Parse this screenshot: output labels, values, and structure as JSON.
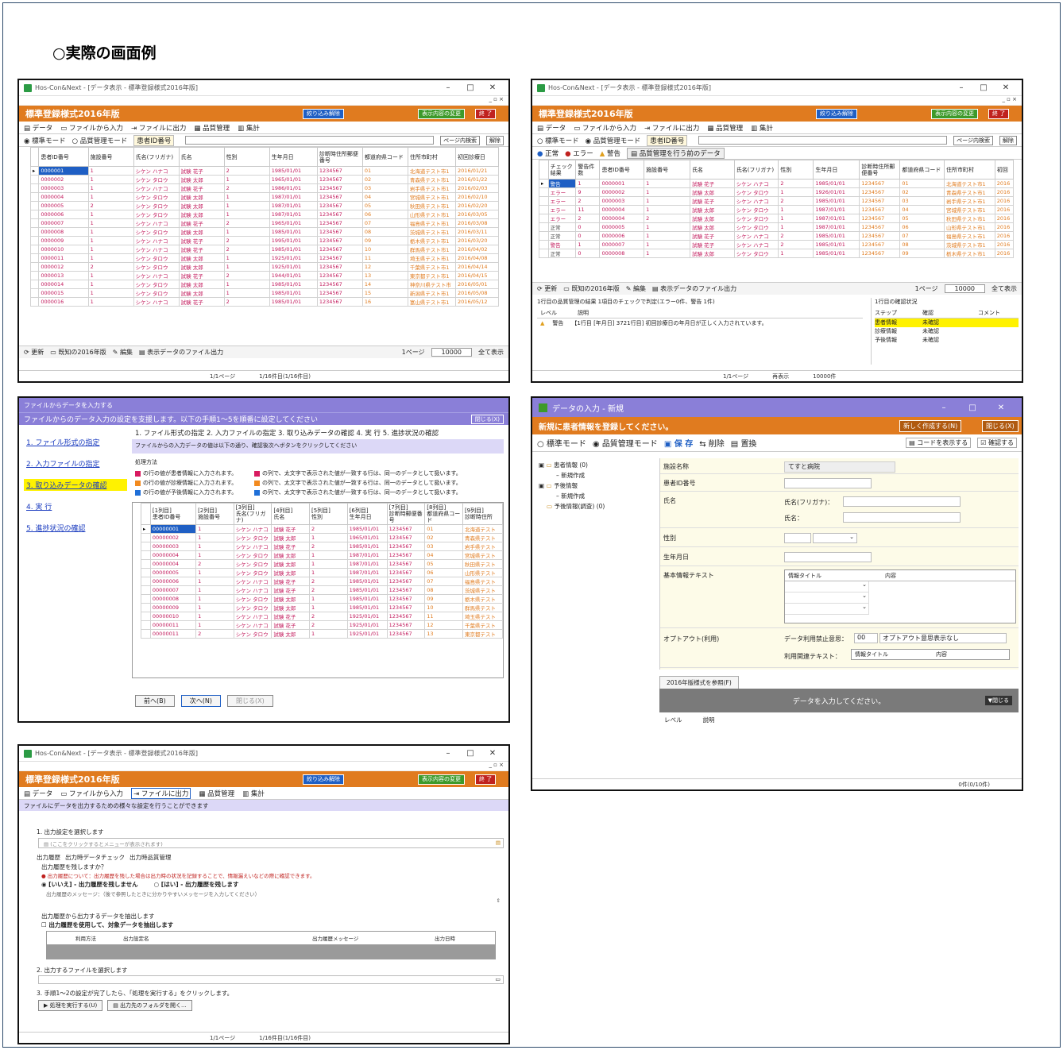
{
  "heading": "○実際の画面例",
  "main_title": "Hos-Con&Next - [データ表示 - 標準登録様式2016年版]",
  "app_banner": "標準登録様式2016年版",
  "banner_buttons": {
    "filter": "絞り込み解除",
    "display": "表示内容の変更",
    "end": "終 了"
  },
  "tabs": [
    "データ",
    "ファイルから入力",
    "ファイルに出力",
    "品質管理",
    "集計"
  ],
  "modes": {
    "standard": "標準モード",
    "quality": "品質管理モード",
    "search_label": "患者ID番号",
    "page_search": "ページ内検索",
    "calc": "解除"
  },
  "grid1": {
    "headers": [
      "患者ID番号",
      "施設番号",
      "氏名(フリガナ)",
      "氏名",
      "性別",
      "生年月日",
      "診断時住所郵便番号",
      "都道府県コード",
      "住所市町村",
      "初回診療日"
    ],
    "rows": [
      [
        "0000001",
        "1",
        "シケン ハナコ",
        "試験 花子",
        "2",
        "1985/01/01",
        "1234567",
        "01",
        "北海道テスト市1",
        "2016/01/21"
      ],
      [
        "0000002",
        "1",
        "シケン タロウ",
        "試験 太郎",
        "1",
        "1965/01/01",
        "1234567",
        "02",
        "青森県テスト市1",
        "2016/01/22"
      ],
      [
        "0000003",
        "1",
        "シケン ハナコ",
        "試験 花子",
        "2",
        "1986/01/01",
        "1234567",
        "03",
        "岩手県テスト市1",
        "2016/02/03"
      ],
      [
        "0000004",
        "1",
        "シケン タロウ",
        "試験 太郎",
        "1",
        "1987/01/01",
        "1234567",
        "04",
        "宮城県テスト市1",
        "2016/02/10"
      ],
      [
        "0000005",
        "2",
        "シケン タロウ",
        "試験 太郎",
        "1",
        "1987/01/01",
        "1234567",
        "05",
        "秋田県テスト市1",
        "2016/02/20"
      ],
      [
        "0000006",
        "1",
        "シケン タロウ",
        "試験 太郎",
        "1",
        "1987/01/01",
        "1234567",
        "06",
        "山形県テスト市1",
        "2016/03/05"
      ],
      [
        "0000007",
        "1",
        "シケン ハナコ",
        "試験 花子",
        "2",
        "1965/01/01",
        "1234567",
        "07",
        "福島県テスト市1",
        "2016/03/08"
      ],
      [
        "0000008",
        "1",
        "シケン タロウ",
        "試験 太郎",
        "1",
        "1985/01/01",
        "1234567",
        "08",
        "茨城県テスト市1",
        "2016/03/11"
      ],
      [
        "0000009",
        "1",
        "シケン ハナコ",
        "試験 花子",
        "2",
        "1995/01/01",
        "1234567",
        "09",
        "栃木県テスト市1",
        "2016/03/20"
      ],
      [
        "0000010",
        "1",
        "シケン ハナコ",
        "試験 花子",
        "2",
        "1985/01/01",
        "1234567",
        "10",
        "群馬県テスト市1",
        "2016/04/02"
      ],
      [
        "0000011",
        "1",
        "シケン タロウ",
        "試験 太郎",
        "1",
        "1925/01/01",
        "1234567",
        "11",
        "埼玉県テスト市1",
        "2016/04/08"
      ],
      [
        "0000012",
        "2",
        "シケン タロウ",
        "試験 太郎",
        "1",
        "1925/01/01",
        "1234567",
        "12",
        "千葉県テスト市1",
        "2016/04/14"
      ],
      [
        "0000013",
        "1",
        "シケン ハナコ",
        "試験 花子",
        "2",
        "1944/01/01",
        "1234567",
        "13",
        "東京都テスト市1",
        "2016/04/15"
      ],
      [
        "0000014",
        "1",
        "シケン タロウ",
        "試験 太郎",
        "1",
        "1985/01/01",
        "1234567",
        "14",
        "神奈川県テスト市",
        "2016/05/01"
      ],
      [
        "0000015",
        "1",
        "シケン タロウ",
        "試験 太郎",
        "1",
        "1985/01/01",
        "1234567",
        "15",
        "新潟県テスト市1",
        "2016/05/08"
      ],
      [
        "0000016",
        "1",
        "シケン ハナコ",
        "試験 花子",
        "2",
        "1985/01/01",
        "1234567",
        "16",
        "富山県テスト市1",
        "2016/05/12"
      ]
    ]
  },
  "bottom_buttons": [
    "更新",
    "既知の2016年版",
    "編集",
    "表示データのファイル出力"
  ],
  "page_info": {
    "per_page_label": "1ページ",
    "per_page_value": "10000",
    "show_all": "全て表示",
    "pages": "1/1ページ",
    "rows": "1/16件目(1/16件目)"
  },
  "quality": {
    "filters": [
      "正常",
      "エラー",
      "警告",
      "品質管理を行う前のデータ"
    ],
    "headers": [
      "チェック結果",
      "警告件数",
      "患者ID番号",
      "施設番号",
      "氏名",
      "氏名(フリガナ)",
      "性別",
      "生年月日",
      "診断時住所郵便番号",
      "都道府県コード",
      "住所市町村",
      "初回"
    ],
    "rows": [
      [
        "警告",
        "1",
        "0000001",
        "1",
        "試験 花子",
        "シケン ハナコ",
        "2",
        "1985/01/01",
        "1234567",
        "01",
        "北海道テスト市1",
        "2016"
      ],
      [
        "エラー",
        "9",
        "0000002",
        "1",
        "試験 太郎",
        "シケン タロウ",
        "1",
        "1926/01/01",
        "1234567",
        "02",
        "青森県テスト市1",
        "2016"
      ],
      [
        "エラー",
        "2",
        "0000003",
        "1",
        "試験 花子",
        "シケン ハナコ",
        "2",
        "1985/01/01",
        "1234567",
        "03",
        "岩手県テスト市1",
        "2016"
      ],
      [
        "エラー",
        "11",
        "0000004",
        "1",
        "試験 太郎",
        "シケン タロウ",
        "1",
        "1987/01/01",
        "1234567",
        "04",
        "宮城県テスト市1",
        "2016"
      ],
      [
        "エラー",
        "2",
        "0000004",
        "2",
        "試験 太郎",
        "シケン タロウ",
        "1",
        "1987/01/01",
        "1234567",
        "05",
        "秋田県テスト市1",
        "2016"
      ],
      [
        "正常",
        "0",
        "0000005",
        "1",
        "試験 太郎",
        "シケン タロウ",
        "1",
        "1987/01/01",
        "1234567",
        "06",
        "山形県テスト市1",
        "2016"
      ],
      [
        "正常",
        "0",
        "0000006",
        "1",
        "試験 花子",
        "シケン ハナコ",
        "2",
        "1985/01/01",
        "1234567",
        "07",
        "福島県テスト市1",
        "2016"
      ],
      [
        "警告",
        "1",
        "0000007",
        "1",
        "試験 花子",
        "シケン ハナコ",
        "2",
        "1985/01/01",
        "1234567",
        "08",
        "茨城県テスト市1",
        "2016"
      ],
      [
        "正常",
        "0",
        "0000008",
        "1",
        "試験 太郎",
        "シケン タロウ",
        "1",
        "1985/01/01",
        "1234567",
        "09",
        "栃木県テスト市1",
        "2016"
      ]
    ],
    "bottom_buttons": [
      "更新",
      "既知の2016年版",
      "編集",
      "表示データのファイル出力"
    ],
    "result_title": "1行目の品質管理の結果 1項目のチェックで判定(エラー0件、警告 1件)",
    "result_headers": [
      "レベル",
      "説明"
    ],
    "result_row": {
      "level": "警告",
      "desc": "【1行目 [年月日] 3721行目] 初回診療日の年月日が正しく入力されています。"
    },
    "status_title": "1行目の確認状況",
    "status_headers": [
      "ステップ",
      "確認",
      "コメント"
    ],
    "status_rows": [
      [
        "患者情報",
        "未確認"
      ],
      [
        "診療情報",
        "未確認"
      ],
      [
        "予後情報",
        "未確認"
      ]
    ],
    "status_bar": [
      "1/1ページ",
      "再表示",
      "10000件"
    ]
  },
  "import": {
    "title": "ファイルからデータを入力する",
    "banner": "ファイルからのデータ入力の設定を支援します。以下の手順1～5を順番に設定してください",
    "close": "閉じる(X)",
    "nav": [
      "1. ファイル形式の指定",
      "2. 入力ファイルの指定",
      "3. 取り込みデータの確認",
      "4. 実 行",
      "5. 進捗状況の確認"
    ],
    "steps": "1. ファイル形式の指定  2. 入力ファイルの指定  3. 取り込みデータの確認  4. 実 行  5. 進捗状況の確認",
    "instruction": "ファイルからの入力データの値は以下の通り、確認後次へボタンをクリックしてください",
    "legend_title": "処理方法",
    "legends": [
      "の行の値が患者情報に入力されます。",
      "の行の値が診療情報に入力されます。",
      "の行の値が予後情報に入力されます。"
    ],
    "legends2": [
      "の列で、太文字で表示された値が一致する行は、同一のデータとして扱います。",
      "の列で、太文字で表示された値が一致する行は、同一のデータとして扱います。",
      "の列で、太文字で表示された値が一致する行は、同一のデータとして扱います。"
    ],
    "headers": [
      "[1列目]\n患者ID番号",
      "[2列目]\n施設番号",
      "[3列目]\n氏名(フリガナ)",
      "[4列目]\n氏名",
      "[5列目]\n性別",
      "[6列目]\n生年月日",
      "[7列目]\n診断時郵便番号",
      "[8列目]\n都道府県コード",
      "[9列目]\n診断時住所"
    ],
    "rows": [
      [
        "00000001",
        "1",
        "シケン ハナコ",
        "試験 花子",
        "2",
        "1985/01/01",
        "1234567",
        "01",
        "北海道テスト"
      ],
      [
        "00000002",
        "1",
        "シケン タロウ",
        "試験 太郎",
        "1",
        "1965/01/01",
        "1234567",
        "02",
        "青森県テスト"
      ],
      [
        "00000003",
        "1",
        "シケン ハナコ",
        "試験 花子",
        "2",
        "1985/01/01",
        "1234567",
        "03",
        "岩手県テスト"
      ],
      [
        "00000004",
        "1",
        "シケン タロウ",
        "試験 太郎",
        "1",
        "1987/01/01",
        "1234567",
        "04",
        "宮城県テスト"
      ],
      [
        "00000004",
        "2",
        "シケン タロウ",
        "試験 太郎",
        "1",
        "1987/01/01",
        "1234567",
        "05",
        "秋田県テスト"
      ],
      [
        "00000005",
        "1",
        "シケン タロウ",
        "試験 太郎",
        "1",
        "1987/01/01",
        "1234567",
        "06",
        "山形県テスト"
      ],
      [
        "00000006",
        "1",
        "シケン ハナコ",
        "試験 花子",
        "2",
        "1985/01/01",
        "1234567",
        "07",
        "福島県テスト"
      ],
      [
        "00000007",
        "1",
        "シケン ハナコ",
        "試験 花子",
        "2",
        "1985/01/01",
        "1234567",
        "08",
        "茨城県テスト"
      ],
      [
        "00000008",
        "1",
        "シケン タロウ",
        "試験 太郎",
        "1",
        "1985/01/01",
        "1234567",
        "09",
        "栃木県テスト"
      ],
      [
        "00000009",
        "1",
        "シケン タロウ",
        "試験 太郎",
        "1",
        "1985/01/01",
        "1234567",
        "10",
        "群馬県テスト"
      ],
      [
        "00000010",
        "1",
        "シケン ハナコ",
        "試験 花子",
        "2",
        "1925/01/01",
        "1234567",
        "11",
        "埼玉県テスト"
      ],
      [
        "00000011",
        "1",
        "シケン ハナコ",
        "試験 花子",
        "2",
        "1925/01/01",
        "1234567",
        "12",
        "千葉県テスト"
      ],
      [
        "00000011",
        "2",
        "シケン タロウ",
        "試験 太郎",
        "1",
        "1925/01/01",
        "1234567",
        "13",
        "東京都テスト"
      ]
    ],
    "buttons": [
      "前へ(B)",
      "次へ(N)",
      "閉じる(X)"
    ]
  },
  "entry": {
    "title": "データの入力 - 新規",
    "banner": "新規に患者情報を登録してください。",
    "new_btn": "新しく作成する(N)",
    "close_btn": "閉じる(X)",
    "modes": [
      "標準モード",
      "品質管理モード",
      "保 存",
      "削除",
      "置換"
    ],
    "right_btns": [
      "コードを表示する",
      "確認する"
    ],
    "tree": [
      "患者情報 (0)",
      "新規作成",
      "予後情報",
      "新規作成",
      "予後情報(調査) (0)"
    ],
    "fields": [
      "施設名称",
      "患者ID番号",
      "氏名",
      "性別",
      "生年月日",
      "基本情報テキスト",
      "オプトアウト(利用)"
    ],
    "facility_value": "てすと病院",
    "kana_label": "氏名(フリガナ)：",
    "name_label": "氏名：",
    "info_title": "情報タイトル",
    "content": "内容",
    "optout_label": "データ利用禁止意思：",
    "optout_code": "00",
    "optout_value": "オプトアウト意思表示なし",
    "related_label": "利用関連テキスト：",
    "ref_btn": "2016年版様式を参照(F)",
    "input_msg": "データを入力してください。",
    "close2": "▼閉じる",
    "msg_headers": [
      "レベル",
      "説明"
    ],
    "status": "0件(0/10件)"
  },
  "export": {
    "sub_banner": "ファイルにデータを出力するための様々な設定を行うことができます",
    "step1": "1. 出力設定を選択します",
    "step1_placeholder": "(ここをクリックするとメニューが表示されます)",
    "subtabs": [
      "出力履歴",
      "出力時データチェック",
      "出力時品質管理"
    ],
    "q": "出力履歴を残しますか？",
    "warn": "出力履歴について：出力履歴を残した場合は出力時の状況を記録することで、情報漏えいなどの際に確認できます。",
    "radio_no": "[いいえ] - 出力履歴を残しません",
    "radio_yes": "[はい] - 出力履歴を残します",
    "msg_label": "出力履歴のメッセージ：（後で参照したときに分かりやすいメッセージを入力してください）",
    "extract": "出力履歴から出力するデータを抽出します",
    "check": "出力履歴を使用して、対象データを抽出します",
    "table_headers": [
      "利用方法",
      "出力設定名",
      "出力履歴メッセージ",
      "出力日時"
    ],
    "step2": "2. 出力するファイルを選択します",
    "step3": "3. 手順1～2の設定が完了したら、「処理を実行する」をクリックします。",
    "run": "処理を実行する(U)",
    "folder": "出力先のフォルダを開く..."
  }
}
